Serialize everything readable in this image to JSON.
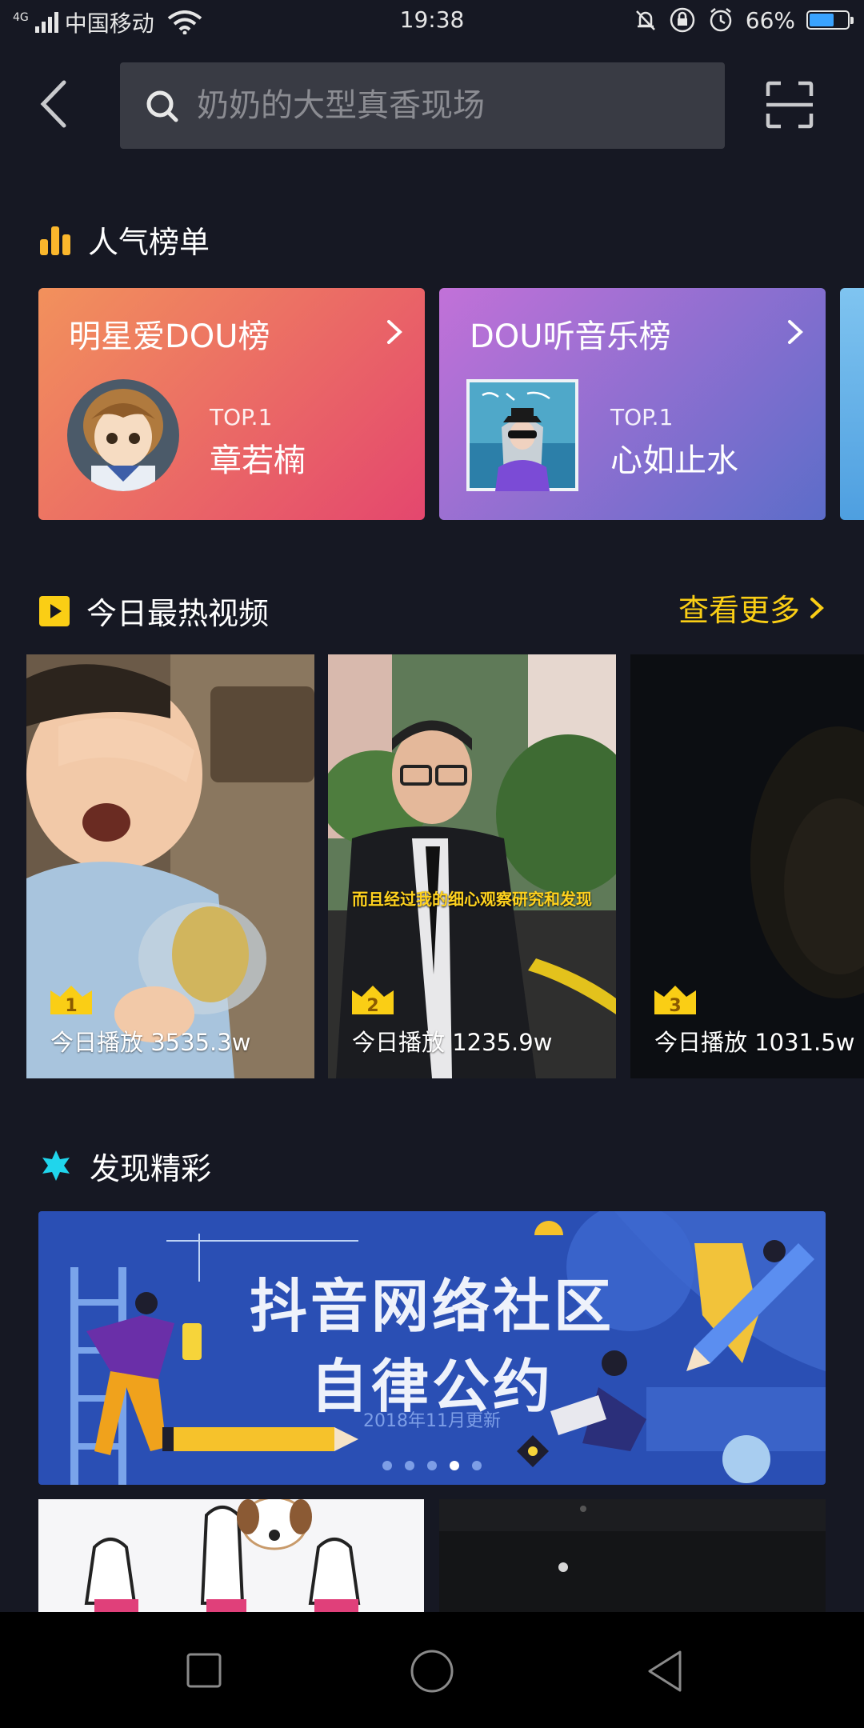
{
  "status_bar": {
    "network": "4G",
    "carrier": "中国移动",
    "time": "19:38",
    "battery_percent": "66%",
    "battery_level": 0.66
  },
  "header": {
    "search_placeholder": "奶奶的大型真香现场"
  },
  "popular": {
    "title": "人气榜单",
    "cards": [
      {
        "name": "明星爱DOU榜",
        "top_label": "TOP.1",
        "winner": "章若楠",
        "gradient": [
          "#f2915c",
          "#e4476e"
        ]
      },
      {
        "name": "DOU听音乐榜",
        "top_label": "TOP.1",
        "winner": "心如止水",
        "gradient": [
          "#c271d8",
          "#5c6dc9"
        ]
      }
    ]
  },
  "hot_videos": {
    "title": "今日最热视频",
    "more_label": "查看更多",
    "items": [
      {
        "rank": "1",
        "plays": "今日播放 3535.3w"
      },
      {
        "rank": "2",
        "plays": "今日播放 1235.9w"
      },
      {
        "rank": "3",
        "plays": "今日播放 1031.5w"
      }
    ],
    "subtitle_2": "而且经过我的细心观察研究和发现"
  },
  "discover": {
    "title": "发现精彩",
    "banner_line1": "抖音网络社区",
    "banner_line2": "自律公约",
    "banner_date": "2018年11月更新",
    "banner_dots": 5,
    "banner_active_dot": 4
  },
  "colors": {
    "background": "#161823",
    "accent_yellow": "#face15",
    "star_cyan": "#20d5ec",
    "banner_blue": "#2a4fb4"
  }
}
